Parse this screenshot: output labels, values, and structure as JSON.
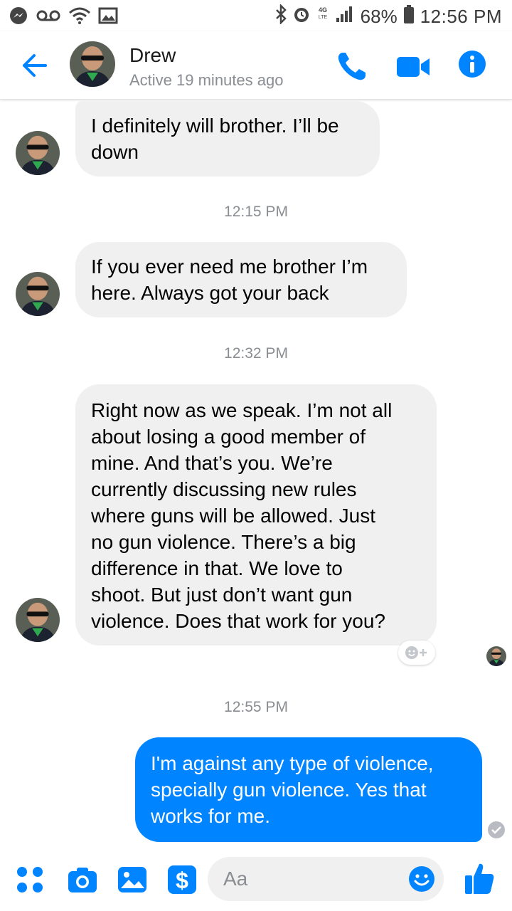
{
  "status_bar": {
    "battery_percent": "68%",
    "time": "12:56 PM",
    "network_label": "4G LTE"
  },
  "header": {
    "contact_name": "Drew",
    "active_status": "Active 19 minutes ago"
  },
  "messages": [
    {
      "from": "Drew",
      "text_lines": [
        "I definitely will brother. I’ll be",
        "down"
      ]
    },
    {
      "timestamp": "12:15 PM"
    },
    {
      "from": "Drew",
      "text_lines": [
        "If you ever need me brother I’m",
        "here. Always got your back"
      ]
    },
    {
      "timestamp": "12:32 PM"
    },
    {
      "from": "Drew",
      "text_lines": [
        "Right now as we speak. I’m not all",
        "about losing a good member of",
        "mine. And that’s you. We’re",
        "currently discussing new rules",
        "where guns will be allowed. Just",
        "no gun violence. There’s a big",
        "difference in that. We love to",
        "shoot. But just don’t want gun",
        "violence. Does that work for you?"
      ]
    },
    {
      "timestamp": "12:55 PM"
    },
    {
      "from": "me",
      "text_lines": [
        "I'm against any type of violence,",
        "specially gun violence. Yes that",
        "works for me."
      ]
    }
  ],
  "composer": {
    "placeholder": "Aa"
  },
  "colors": {
    "messenger_blue": "#0084ff",
    "incoming_bubble": "#f0f0f0",
    "secondary_text": "#8a8d91"
  },
  "icons": [
    "voicemail-icon",
    "wifi-icon",
    "gallery-icon",
    "bluetooth-icon",
    "alarm-icon",
    "signal-icon",
    "battery-icon",
    "back-arrow-icon",
    "phone-icon",
    "video-camera-icon",
    "info-icon",
    "add-reaction-icon",
    "sent-check-icon",
    "more-apps-icon",
    "camera-icon",
    "image-icon",
    "payments-icon",
    "emoji-icon",
    "thumbs-up-icon"
  ]
}
